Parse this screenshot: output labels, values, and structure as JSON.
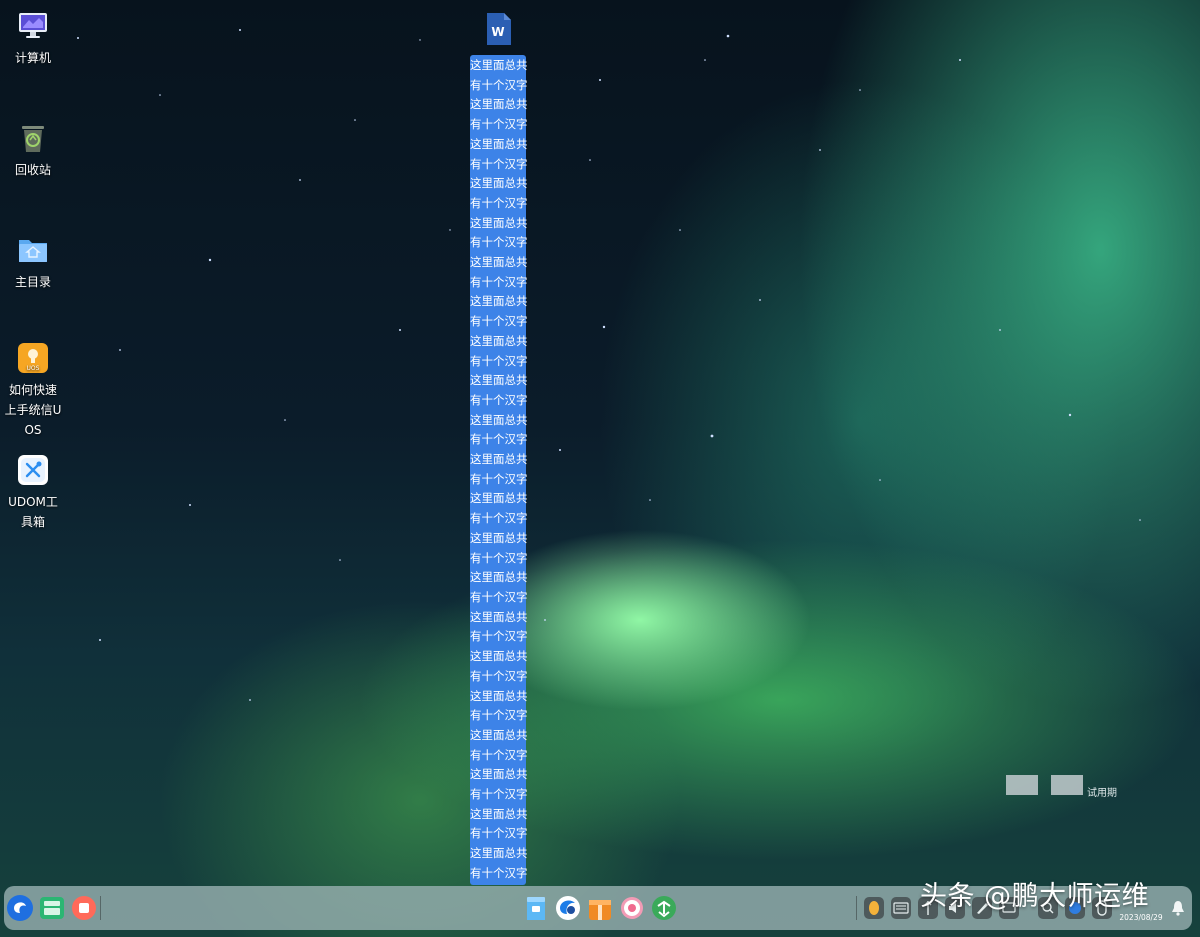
{
  "desktop": {
    "icons": [
      {
        "label": "计算机",
        "icon": "computer-icon"
      },
      {
        "label": "回收站",
        "icon": "trash-icon"
      },
      {
        "label": "主目录",
        "icon": "home-folder-icon"
      },
      {
        "label": "如何快速上手统信UOS",
        "icon": "uos-guide-icon",
        "badge": "UOS"
      },
      {
        "label": "UDOM工具箱",
        "icon": "toolbox-icon"
      }
    ],
    "file": {
      "icon": "word-doc-icon",
      "icon_letter": "W",
      "selected_name_lines": [
        "这里面总共",
        "有十个汉字",
        "这里面总共",
        "有十个汉字",
        "这里面总共",
        "有十个汉字",
        "这里面总共",
        "有十个汉字",
        "这里面总共",
        "有十个汉字",
        "这里面总共",
        "有十个汉字",
        "这里面总共",
        "有十个汉字",
        "这里面总共",
        "有十个汉字",
        "这里面总共",
        "有十个汉字",
        "这里面总共",
        "有十个汉字",
        "这里面总共",
        "有十个汉字",
        "这里面总共",
        "有十个汉字",
        "这里面总共",
        "有十个汉字",
        "这里面总共",
        "有十个汉字",
        "这里面总共",
        "有十个汉字",
        "这里面总共",
        "有十个汉字",
        "这里面总共",
        "有十个汉字",
        "这里面总共",
        "有十个汉字",
        "这里面总共",
        "有十个汉字",
        "这里面总共",
        "有十个汉字",
        "这里面总共",
        "有十个汉字"
      ]
    },
    "trial_text": "试用期"
  },
  "taskbar": {
    "left_apps": [
      "launcher-icon",
      "multitask-view-icon",
      "screen-record-icon"
    ],
    "center_apps": [
      "file-manager-icon",
      "browser-icon",
      "app-store-icon",
      "control-center-icon",
      "downloader-icon"
    ],
    "tray": [
      "input-method-icon",
      "keyboard-icon",
      "usb-icon",
      "volume-icon",
      "pen-icon",
      "display-icon",
      "search-icon",
      "network-icon",
      "mouse-icon",
      "notification-icon"
    ],
    "clock_time": "",
    "clock_date": "2023/08/29"
  },
  "watermark": "头条 @鹏大师运维",
  "colors": {
    "selection": "#3d83e8",
    "taskbar": "#96afaf"
  }
}
